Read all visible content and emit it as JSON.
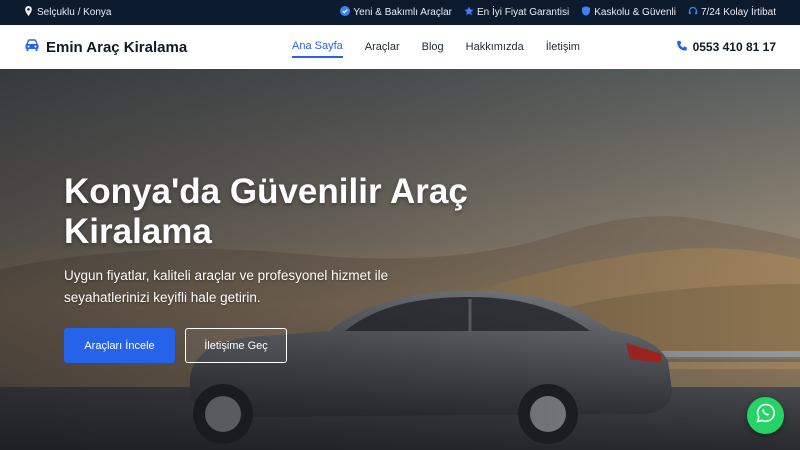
{
  "topbar": {
    "location": "Selçuklu / Konya",
    "features": [
      {
        "label": "Yeni & Bakımlı Araçlar",
        "icon": "check-circle-icon"
      },
      {
        "label": "En İyi Fiyat Garantisi",
        "icon": "star-icon"
      },
      {
        "label": "Kaskolu & Güvenli",
        "icon": "shield-icon"
      },
      {
        "label": "7/24 Kolay İrtibat",
        "icon": "headset-icon"
      }
    ]
  },
  "nav": {
    "brand": "Emin Araç Kiralama",
    "items": [
      {
        "label": "Ana Sayfa",
        "active": true
      },
      {
        "label": "Araçlar"
      },
      {
        "label": "Blog"
      },
      {
        "label": "Hakkımızda"
      },
      {
        "label": "İletişim"
      }
    ],
    "phone": "0553 410 81 17"
  },
  "hero": {
    "title": "Konya'da Güvenilir Araç Kiralama",
    "subtitle": "Uygun fiyatlar, kaliteli araçlar ve profesyonel hizmet ile seyahatlerinizi keyifli hale getirin.",
    "primary_button": "Araçları İncele",
    "secondary_button": "İletişime Geç"
  },
  "colors": {
    "accent": "#2563eb",
    "topbar_bg": "#0d1b2f",
    "whatsapp": "#25d366"
  }
}
